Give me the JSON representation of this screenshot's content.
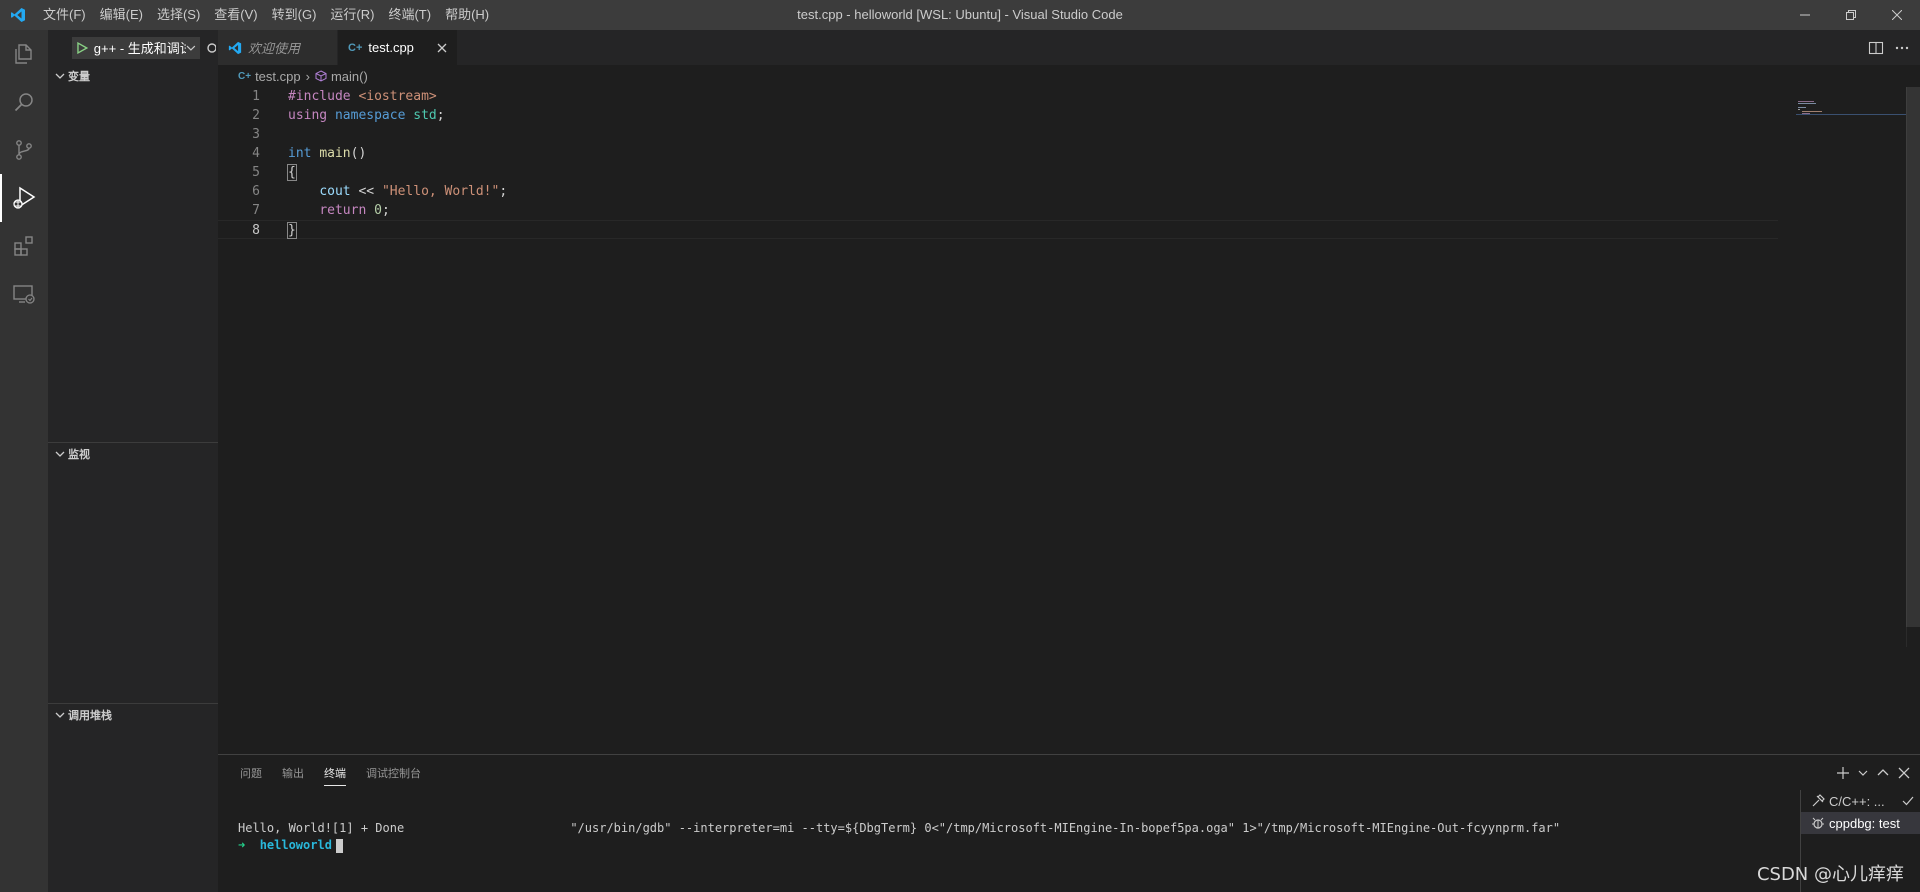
{
  "window": {
    "title": "test.cpp - helloworld [WSL: Ubuntu] - Visual Studio Code",
    "menu": [
      "文件(F)",
      "编辑(E)",
      "选择(S)",
      "查看(V)",
      "转到(G)",
      "运行(R)",
      "终端(T)",
      "帮助(H)"
    ]
  },
  "sidebar": {
    "launch_config": "g++ - 生成和调试活动文件",
    "sections": {
      "variables": "变量",
      "watch": "监视",
      "call_stack": "调用堆栈"
    }
  },
  "editor": {
    "tabs": [
      {
        "label": "欢迎使用"
      },
      {
        "label": "test.cpp"
      }
    ],
    "breadcrumb": {
      "file": "test.cpp",
      "symbol": "main()"
    },
    "line_numbers": [
      "1",
      "2",
      "3",
      "4",
      "5",
      "6",
      "7",
      "8"
    ],
    "code": {
      "l1_pre": "#include ",
      "l1_inc": "<iostream>",
      "l2_using": "using",
      "l2_ns_kw": "namespace",
      "l2_std": "std",
      "l2_semi": ";",
      "l4_int": "int",
      "l4_main": "main",
      "l4_paren": "()",
      "l5_brace": "{",
      "l6_indent": "    ",
      "l6_cout": "cout",
      "l6_op": " << ",
      "l6_str": "\"Hello, World!\"",
      "l6_semi": ";",
      "l7_indent": "    ",
      "l7_ret": "return",
      "l7_sp": " ",
      "l7_num": "0",
      "l7_semi": ";",
      "l8_brace": "}"
    }
  },
  "panel": {
    "tabs": [
      "问题",
      "输出",
      "终端",
      "调试控制台"
    ],
    "terminal": {
      "line1": "Hello, World![1] + Done                       \"/usr/bin/gdb\" --interpreter=mi --tty=${DbgTerm} 0<\"/tmp/Microsoft-MIEngine-In-bopef5pa.oga\" 1>\"/tmp/Microsoft-MIEngine-Out-fcyynprm.far\"",
      "prompt_arrow": "➜",
      "prompt_dir": "helloworld"
    },
    "terminal_list": [
      {
        "label": "C/C++: ...",
        "icon": "tools-icon"
      },
      {
        "label": "cppdbg: test",
        "icon": "debug-icon"
      }
    ]
  },
  "watermark": "CSDN @心儿痒痒",
  "colors": {
    "titlebar": "#3c3c3c",
    "activitybar": "#333333",
    "sidebar": "#252526",
    "editor": "#1e1e1e",
    "accent": "#0078d4"
  }
}
